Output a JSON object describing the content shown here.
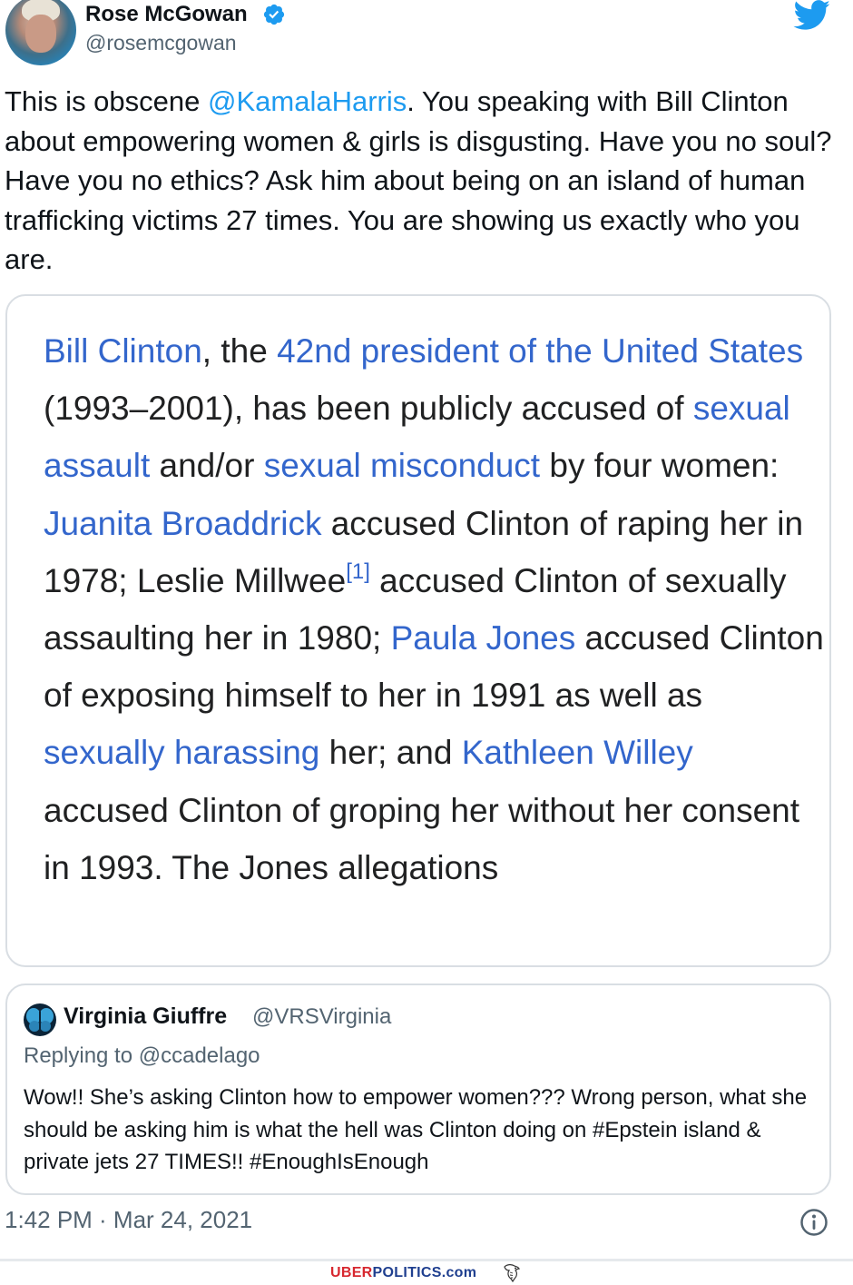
{
  "author": {
    "name": "Rose McGowan",
    "handle": "@rosemcgowan",
    "verified_icon": "verified-badge-icon",
    "avatar": "profile-photo"
  },
  "platform_icon": "twitter-bird-icon",
  "tweet": {
    "text_before": "This is obscene ",
    "mention": "@KamalaHarris",
    "text_after": ". You speaking with Bill Clinton about empowering women & girls is disgusting. Have you no soul? Have you no ethics? Ask him about being on an island of human trafficking victims 27 times. You are showing us exactly who you are."
  },
  "image_card": {
    "segments": [
      {
        "text": "Bill Clinton",
        "link": true
      },
      {
        "text": ", the ",
        "link": false
      },
      {
        "text": "42nd president of the United States",
        "link": true
      },
      {
        "text": " (1993–2001), has been publicly accused of ",
        "link": false
      },
      {
        "text": "sexual assault",
        "link": true
      },
      {
        "text": " and/or ",
        "link": false
      },
      {
        "text": "sexual misconduct",
        "link": true
      },
      {
        "text": " by four women: ",
        "link": false
      },
      {
        "text": "Juanita Broaddrick",
        "link": true
      },
      {
        "text": " accused Clinton of raping her in 1978; Leslie Millwee",
        "link": false
      },
      {
        "text": "[1]",
        "link": true,
        "sup": true
      },
      {
        "text": " accused Clinton of sexually assaulting her in 1980; ",
        "link": false
      },
      {
        "text": "Paula Jones",
        "link": true
      },
      {
        "text": " accused Clinton of exposing himself to her in 1991 as well as ",
        "link": false
      },
      {
        "text": "sexually harassing",
        "link": true
      },
      {
        "text": " her; and ",
        "link": false
      },
      {
        "text": "Kathleen Willey",
        "link": true
      },
      {
        "text": " accused Clinton of groping her without her consent in 1993. The Jones allegations",
        "link": false
      }
    ],
    "link_color": "#3366cc"
  },
  "quoted_tweet": {
    "name": "Virginia Giuffre",
    "handle": "@VRSVirginia",
    "replying_to": "Replying to @ccadelago",
    "text": "Wow!! She’s asking Clinton how to empower women??? Wrong person, what she should be asking him is what the hell was Clinton doing on #Epstein island & private jets 27 TIMES!! #EnoughIsEnough",
    "avatar_icon": "butterfly-icon"
  },
  "timestamp": "1:42 PM · Mar 24, 2021",
  "info_icon": "info-icon",
  "watermark": {
    "part1": "UBER",
    "part2": "POLITICS",
    "part3": ".com",
    "icon": "eagle-icon"
  },
  "colors": {
    "accent": "#1d9bf0",
    "text": "#0f1419",
    "secondary": "#536471",
    "border": "#d9dee3"
  }
}
